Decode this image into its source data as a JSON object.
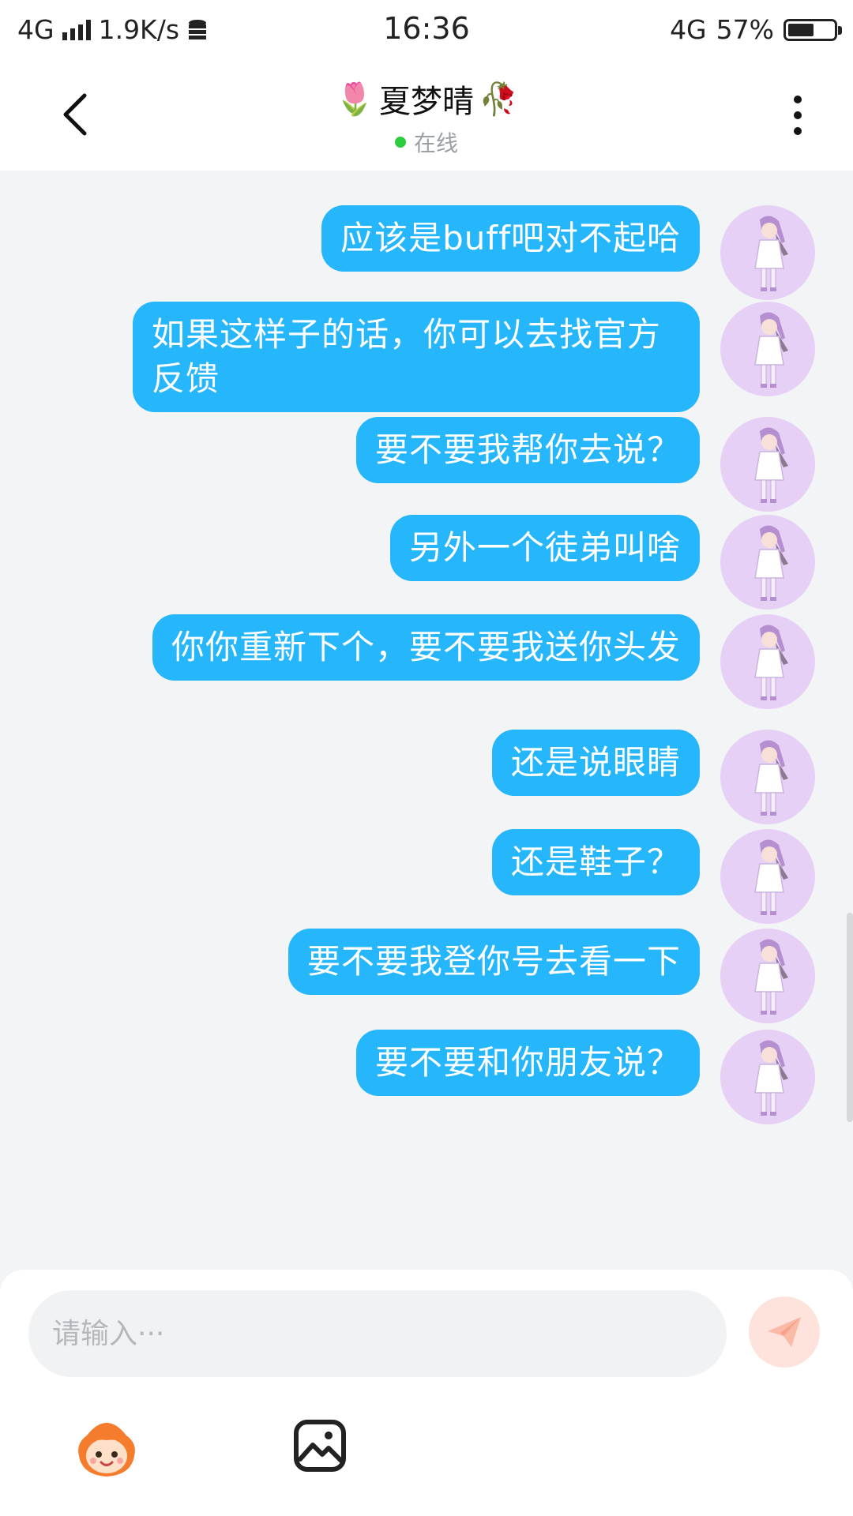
{
  "status_bar": {
    "network_left": "4G",
    "speed": "1.9K/s",
    "time": "16:36",
    "network_right": "4G",
    "battery": "57%",
    "battery_level": 0.57
  },
  "header": {
    "title": "夏梦晴",
    "title_left_emoji": "🌷",
    "title_right_emoji": "🥀",
    "status": "在线",
    "status_color": "#2ecc40"
  },
  "messages": [
    {
      "text": "应该是buff吧对不起哈"
    },
    {
      "text": "如果这样子的话，你可以去找官方反馈"
    },
    {
      "text": "要不要我帮你去说？"
    },
    {
      "text": "另外一个徒弟叫啥"
    },
    {
      "text": "你你重新下个，要不要我送你头发"
    },
    {
      "text": "还是说眼睛"
    },
    {
      "text": "还是鞋子？"
    },
    {
      "text": "要不要我登你号去看一下"
    },
    {
      "text": "要不要和你朋友说？"
    }
  ],
  "input": {
    "placeholder": "请输入···"
  },
  "colors": {
    "bubble": "#25b6fb",
    "avatar_bg": "#e6d0f6",
    "send": "#fde3dc"
  },
  "icons": {
    "back": "chevron-left-icon",
    "more": "more-vertical-icon",
    "send": "send-icon",
    "emoji": "emoji-face-icon",
    "image": "image-icon"
  }
}
